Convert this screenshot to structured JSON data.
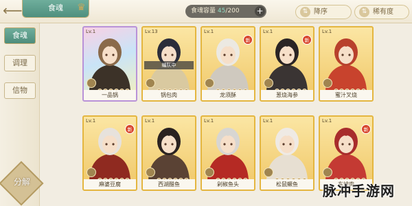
{
  "header": {
    "title": "食魂",
    "capacity_label": "食魂容量",
    "capacity_current": "45",
    "capacity_max": "/200",
    "plus": "+",
    "sort_primary": "降序",
    "sort_secondary": "稀有度"
  },
  "sidebar": {
    "tabs": [
      {
        "label": "食魂",
        "active": true
      },
      {
        "label": "调理",
        "active": false
      },
      {
        "label": "信物",
        "active": false
      }
    ],
    "decompose": "分解"
  },
  "cards": [
    {
      "name": "一品锅",
      "level": "Lv.1",
      "frame": "rainbow",
      "hair": "#8a6a4a",
      "outfit": "#3c3228",
      "new": false,
      "team": ""
    },
    {
      "name": "锅包肉",
      "level": "Lv.13",
      "frame": "gold",
      "hair": "#2b2d3a",
      "outfit": "#d9c9a0",
      "new": false,
      "team": "编队中"
    },
    {
      "name": "龙须酥",
      "level": "Lv.1",
      "frame": "gold",
      "hair": "#ece9e2",
      "outfit": "#cfc9bf",
      "new": true,
      "team": ""
    },
    {
      "name": "葱烧海参",
      "level": "Lv.1",
      "frame": "gold",
      "hair": "#2a2424",
      "outfit": "#3a3433",
      "new": true,
      "team": ""
    },
    {
      "name": "蜜汁叉烧",
      "level": "Lv.1",
      "frame": "gold",
      "hair": "#b8402c",
      "outfit": "#c8432d",
      "new": false,
      "team": ""
    },
    {
      "name": "麻婆豆腐",
      "level": "Lv.1",
      "frame": "gold",
      "hair": "#e7e2dc",
      "outfit": "#8f2a20",
      "new": true,
      "team": ""
    },
    {
      "name": "西湖醋鱼",
      "level": "Lv.1",
      "frame": "gold",
      "hair": "#2a2220",
      "outfit": "#5a4234",
      "new": false,
      "team": ""
    },
    {
      "name": "剁椒鱼头",
      "level": "Lv.1",
      "frame": "gold",
      "hair": "#d8d6d2",
      "outfit": "#b52a24",
      "new": false,
      "team": ""
    },
    {
      "name": "松鼠鳜鱼",
      "level": "Lv.1",
      "frame": "gold",
      "hair": "#efeae4",
      "outfit": "#e7dfd2",
      "new": false,
      "team": ""
    },
    {
      "name": "东坡肉",
      "level": "Lv.1",
      "frame": "gold",
      "hair": "#a82c2c",
      "outfit": "#c43a33",
      "new": true,
      "team": ""
    }
  ],
  "new_badge": "新",
  "watermark": "脉冲手游网"
}
